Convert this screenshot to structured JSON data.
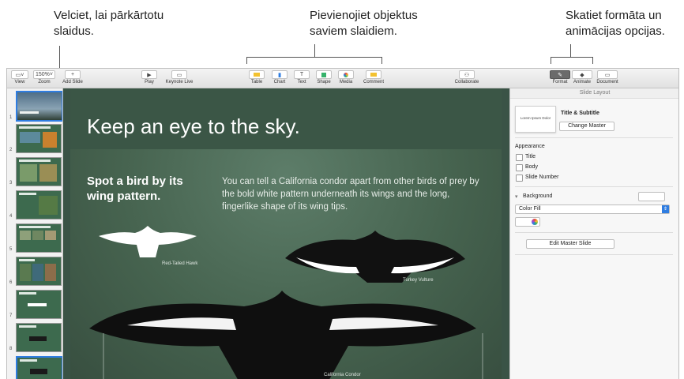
{
  "callouts": {
    "left_line1": "Velciet, lai pārkārtotu",
    "left_line2": "slaidus.",
    "mid_line1": "Pievienojiet objektus",
    "mid_line2": "saviem slaidiem.",
    "right_line1": "Skatiet formāta un",
    "right_line2": "animācijas opcijas."
  },
  "toolbar": {
    "view": "View",
    "zoom": "Zoom",
    "zoom_value": "150%",
    "add_slide": "Add Slide",
    "play": "Play",
    "keynote_live": "Keynote Live",
    "table": "Table",
    "chart": "Chart",
    "text": "Text",
    "shape": "Shape",
    "media": "Media",
    "comment": "Comment",
    "collaborate": "Collaborate",
    "format": "Format",
    "animate": "Animate",
    "document": "Document"
  },
  "navigator": {
    "slide_numbers": [
      "1",
      "2",
      "3",
      "4",
      "5",
      "6",
      "7",
      "8",
      "9"
    ]
  },
  "slide": {
    "title": "Keep an eye to the sky.",
    "subtitle": "Spot a bird by its wing pattern.",
    "body": "You can tell a California condor apart from other birds of prey by the bold white pattern underneath its wings and the long, fingerlike shape of its wing tips.",
    "caption_hawk": "Red-Tailed Hawk",
    "caption_vulture": "Turkey Vulture",
    "caption_condor": "California Condor"
  },
  "inspector": {
    "header": "Slide Layout",
    "preview_text": "Lorem Ipsum Dolor",
    "layout_name": "Title & Subtitle",
    "change_master": "Change Master",
    "appearance": "Appearance",
    "opt_title": "Title",
    "opt_body": "Body",
    "opt_slide_number": "Slide Number",
    "background": "Background",
    "fill_type": "Color Fill",
    "edit_master": "Edit Master Slide"
  },
  "colors": {
    "accent": "#2f7de1",
    "slide_green": "#46634f"
  }
}
